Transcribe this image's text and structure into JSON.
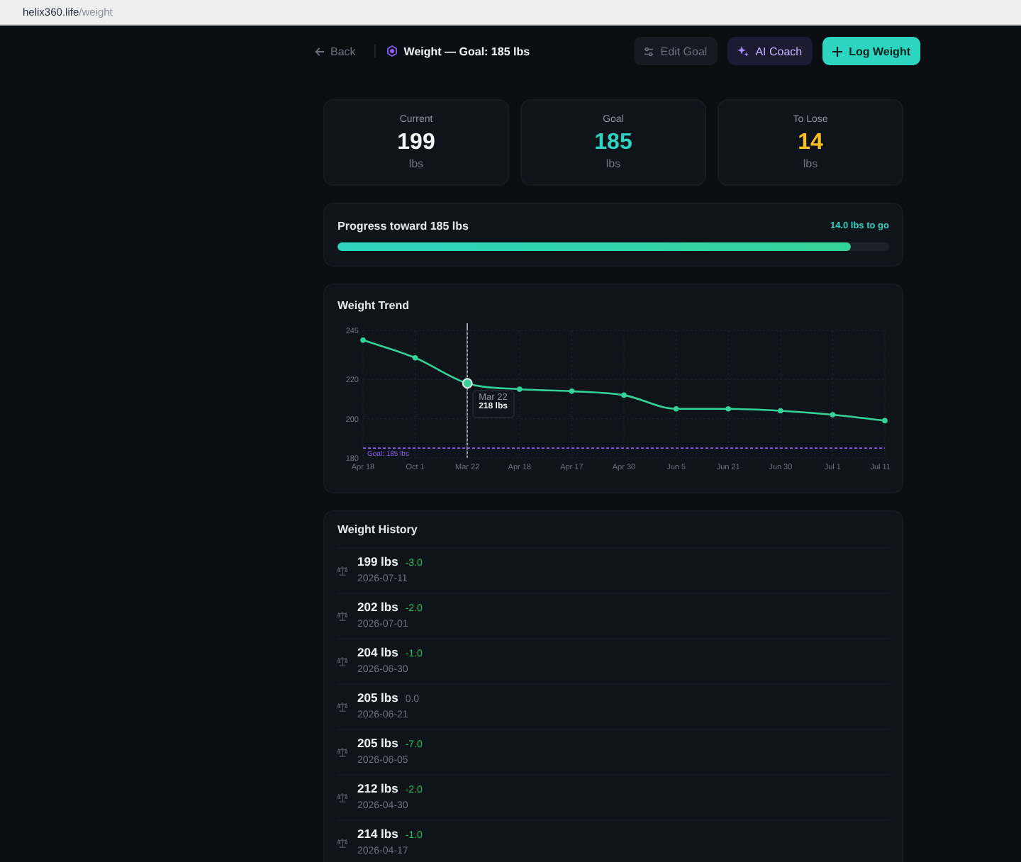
{
  "browser": {
    "host": "helix360.life",
    "path": "/weight"
  },
  "header": {
    "back": "Back",
    "title": "Weight — Goal: 185 lbs",
    "actions": [
      {
        "kind": "ghost",
        "label": "Edit Goal"
      },
      {
        "kind": "accent",
        "label": "AI Coach"
      },
      {
        "kind": "primary",
        "label": "Log Weight"
      }
    ]
  },
  "stats": [
    {
      "label": "Current",
      "value": "199",
      "unit": "lbs",
      "color": "#f3f4f6"
    },
    {
      "label": "Goal",
      "value": "185",
      "unit": "lbs",
      "color": "#2dd4bf"
    },
    {
      "label": "To Lose",
      "value": "14",
      "unit": "lbs",
      "color": "#fbbf24"
    }
  ],
  "progress": {
    "title": "Progress toward 185 lbs",
    "remaining": "14.0 lbs to go",
    "level": 0.93
  },
  "trend": {
    "title": "Weight Trend",
    "chart_data": {
      "type": "line",
      "categories": [
        "Apr 18",
        "Oct 1",
        "Mar 22",
        "Apr 18",
        "Apr 17",
        "Apr 30",
        "Jun 5",
        "Jun 21",
        "Jun 30",
        "Jul 1",
        "Jul 11"
      ],
      "series": [
        {
          "color": "#34d399",
          "marker": "circle",
          "values": [
            240,
            231,
            218,
            215,
            214,
            212,
            205,
            205,
            204,
            202,
            199
          ]
        }
      ],
      "ylim": [
        180,
        245
      ],
      "yticks": [
        180,
        200,
        220,
        245
      ],
      "grid": true,
      "ref_lines": [
        {
          "axis": "y",
          "value": 185,
          "label": "Goal: 185 lbs",
          "color": "#8b5cf6"
        }
      ],
      "annotations": [
        {
          "x": "Mar 22",
          "y": 218,
          "text": "Mar 22"
        },
        {
          "x": "Mar 22",
          "y": 218,
          "text": "218 lbs"
        }
      ]
    }
  },
  "history": {
    "title": "Weight History",
    "entries": [
      {
        "weight": "199 lbs",
        "change": "-3.0",
        "color": "#22c55e",
        "date": "2026-07-11"
      },
      {
        "weight": "202 lbs",
        "change": "-2.0",
        "color": "#22c55e",
        "date": "2026-07-01"
      },
      {
        "weight": "204 lbs",
        "change": "-1.0",
        "color": "#22c55e",
        "date": "2026-06-30"
      },
      {
        "weight": "205 lbs",
        "change": "0.0",
        "color": "#6b7280",
        "date": "2026-06-21"
      },
      {
        "weight": "205 lbs",
        "change": "-7.0",
        "color": "#22c55e",
        "date": "2026-06-05"
      },
      {
        "weight": "212 lbs",
        "change": "-2.0",
        "color": "#22c55e",
        "date": "2026-04-30"
      },
      {
        "weight": "214 lbs",
        "change": "-1.0",
        "color": "#22c55e",
        "date": "2026-04-17"
      }
    ]
  }
}
